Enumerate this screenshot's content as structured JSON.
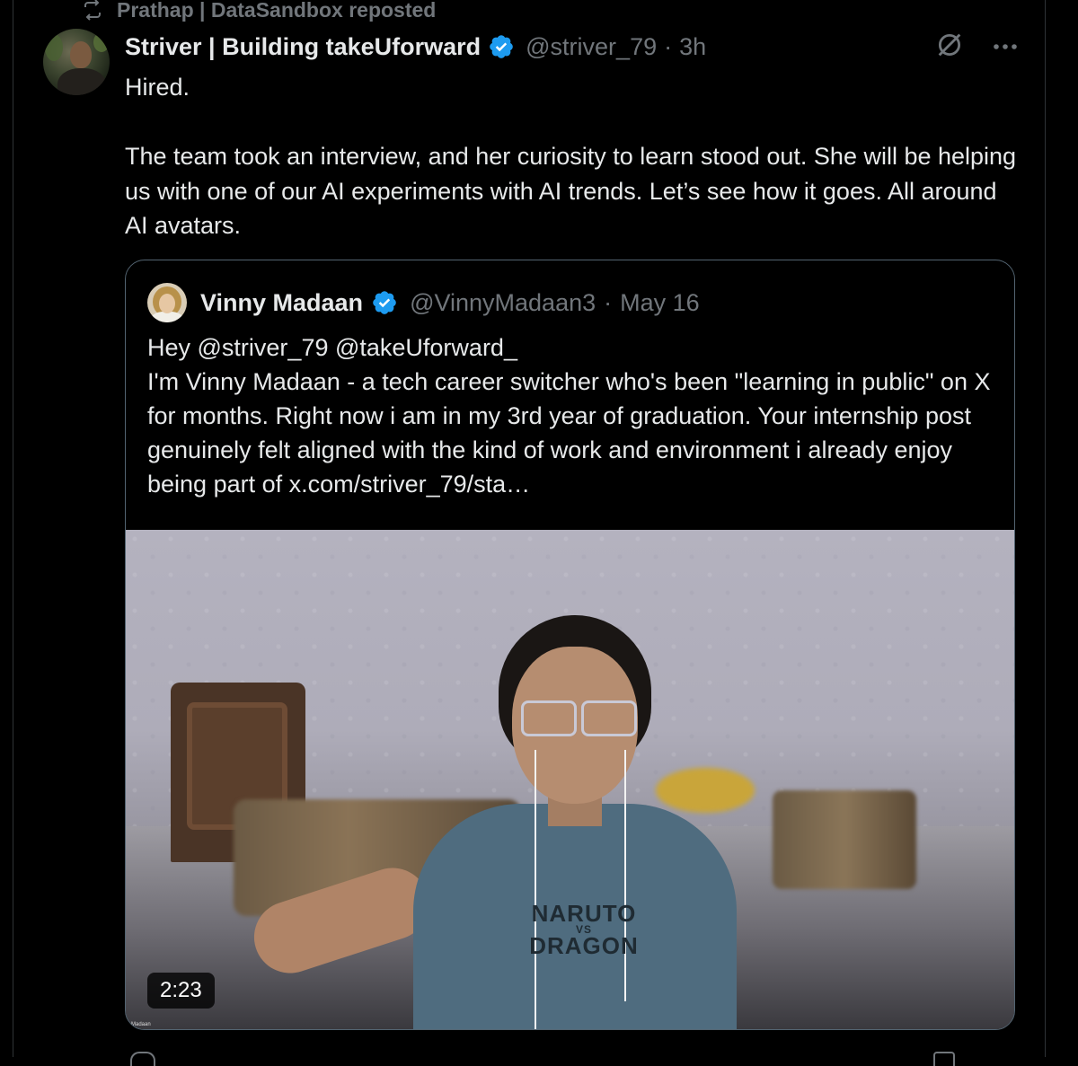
{
  "repost": {
    "text": "Prathap | DataSandbox reposted",
    "icon": "repost-icon"
  },
  "tweet": {
    "author_name": "Striver | Building takeUforward",
    "handle": "@striver_79",
    "separator": "·",
    "time": "3h",
    "verified_icon": "verified-badge-icon",
    "actions": {
      "grok_icon": "grok-icon",
      "more_icon": "more-icon"
    },
    "text_line1": "Hired.",
    "text_line2": "The team took an interview, and her curiosity to learn stood out. She will be helping us with one of our AI experiments with AI trends. Let’s see how it goes. All around AI avatars."
  },
  "quote": {
    "author_name": "Vinny Madaan",
    "handle": "@VinnyMadaan3",
    "separator": "·",
    "date": "May 16",
    "line1": "Hey @striver_79 @takeUforward_",
    "line2": "I'm Vinny Madaan - a tech career switcher who's been \"learning in public\" on X for months. Right now i am in my 3rd year of graduation. Your internship post genuinely felt aligned with the kind of work and environment i already enjoy being part of  x.com/striver_79/sta…",
    "video_duration": "2:23",
    "shirt_text_top": "NARUTO",
    "shirt_text_mid": "VS",
    "shirt_text_bottom": "DRAGON",
    "tiny_caption": "Madaan"
  },
  "colors": {
    "background": "#000000",
    "text": "#e7e9ea",
    "muted": "#71767b",
    "verified": "#1d9bf0",
    "border": "#2f3336"
  }
}
